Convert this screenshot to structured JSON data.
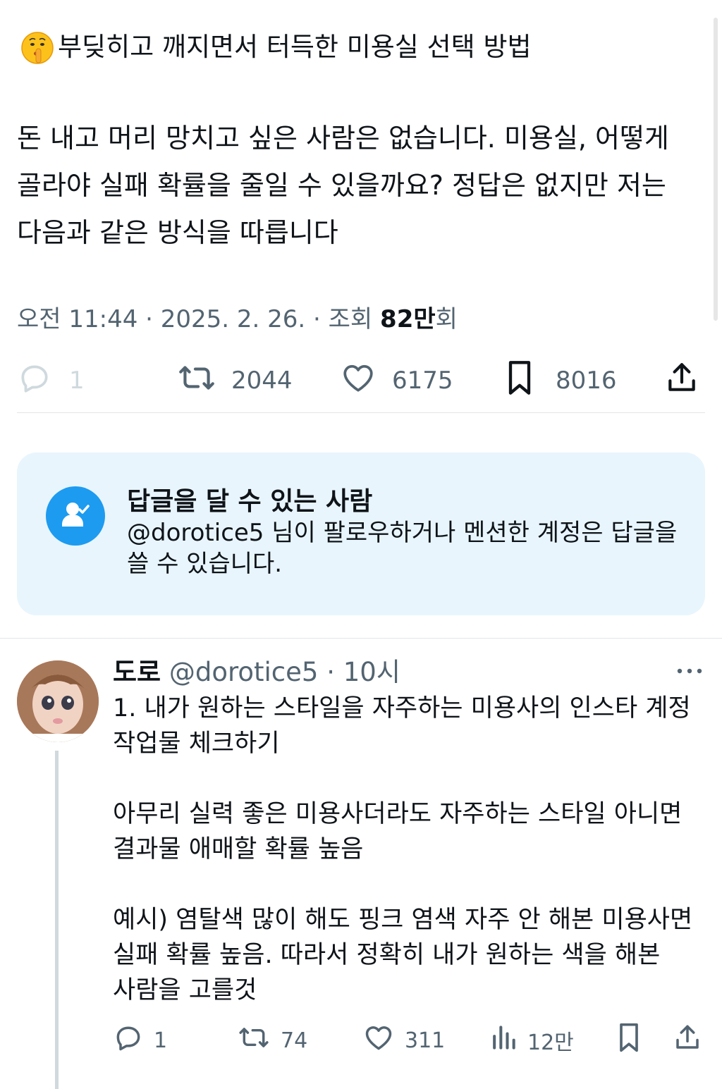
{
  "tweet": {
    "title": "부딪히고 깨지면서 터득한 미용실 선택 방법",
    "body": "돈 내고 머리 망치고 싶은 사람은 없습니다. 미용실, 어떻게 골라야 실패 확률을 줄일 수 있을까요? 정답은 없지만 저는 다음과 같은 방식을 따릅니다",
    "time": "오전 11:44 · 2025. 2. 26. · 조회 ",
    "views_number": "82만",
    "views_suffix": "회",
    "stats": {
      "replies": "1",
      "retweets": "2044",
      "likes": "6175",
      "bookmarks": "8016"
    }
  },
  "reply_restriction": {
    "title": "답글을 달 수 있는 사람",
    "description": "@dorotice5 님이 팔로우하거나 멘션한 계정은 답글을 쓸 수 있습니다."
  },
  "reply": {
    "name": "도로",
    "handle": "@dorotice5",
    "separator": " · ",
    "time": "10시",
    "text": "1. 내가 원하는 스타일을 자주하는 미용사의 인스타 계정 작업물 체크하기\n\n아무리 실력 좋은 미용사더라도 자주하는 스타일 아니면 결과물 애매할 확률 높음\n\n예시) 염탈색 많이 해도 핑크 염색 자주 안 해본 미용사면 실패 확률 높음. 따라서 정확히 내가 원하는 색을 해본 사람을 고를것",
    "stats": {
      "replies": "1",
      "retweets": "74",
      "likes": "311",
      "views": "12만"
    }
  },
  "colors": {
    "accent": "#1d9bf0",
    "muted": "#536471",
    "text": "#0f1419",
    "reply_box_bg": "#e8f5fd"
  }
}
